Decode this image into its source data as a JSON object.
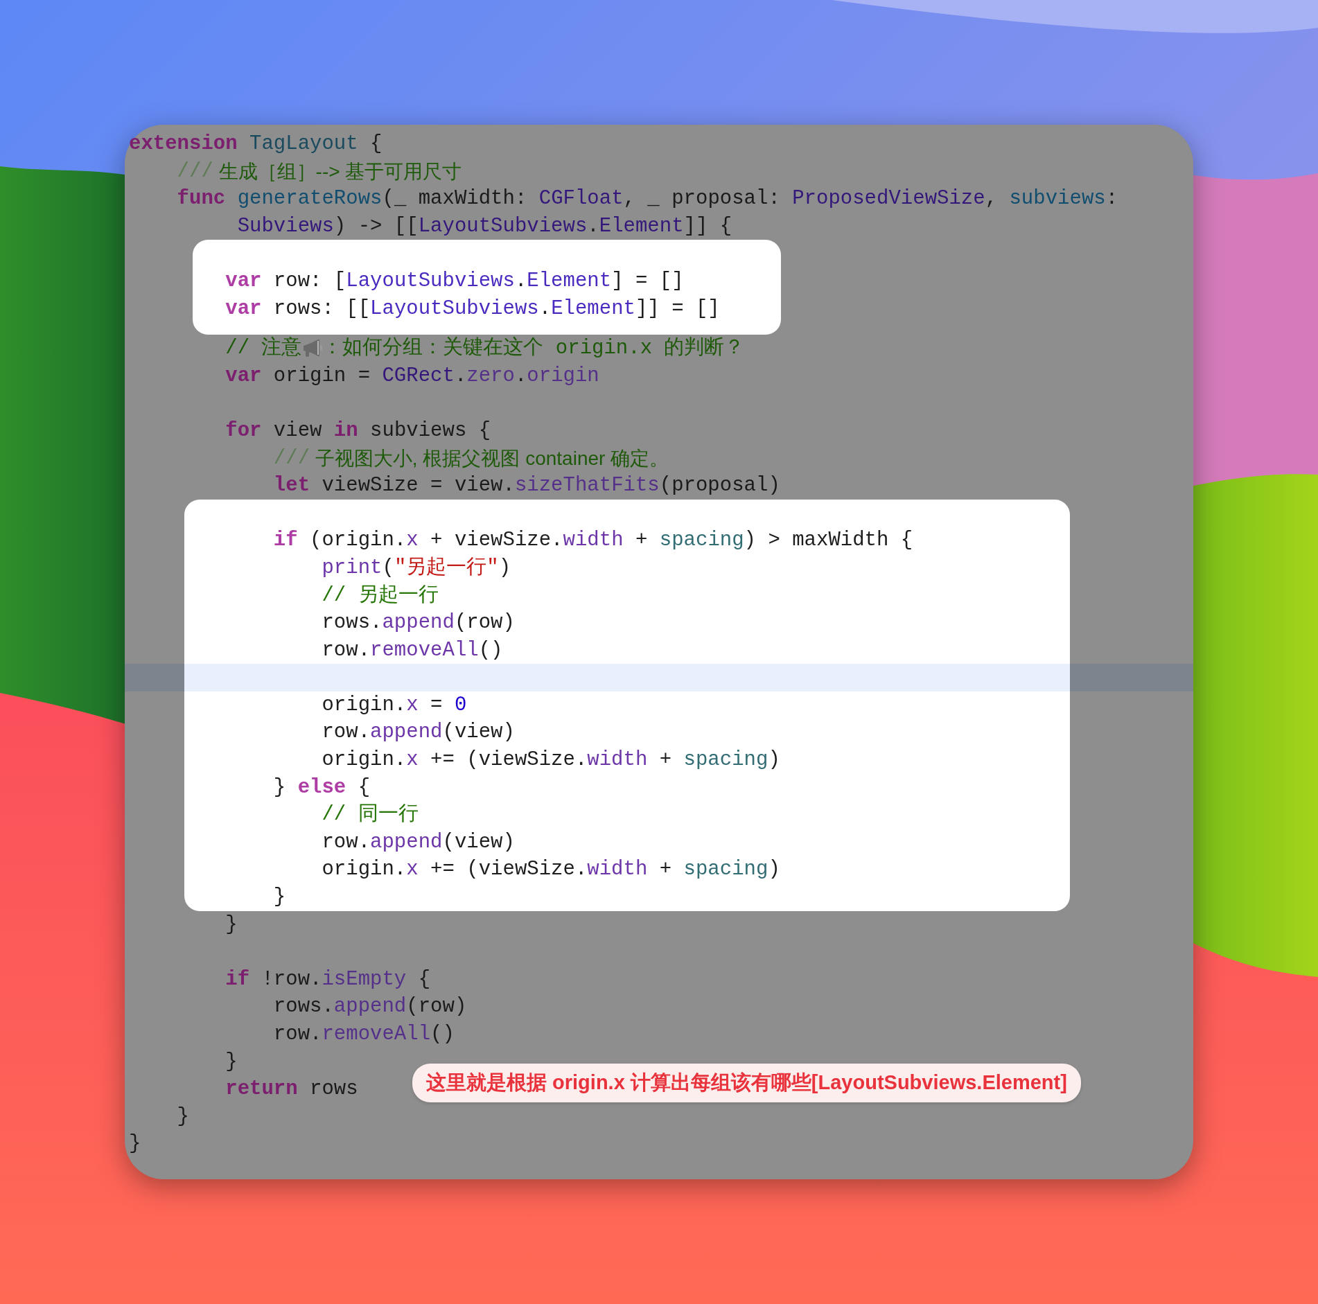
{
  "code_window": {
    "blocks": [
      {
        "highlighted": false,
        "lines": [
          {
            "current": false,
            "tokens": [
              {
                "text": "extension",
                "kind": "keyword"
              },
              {
                "text": " TagLayout",
                "kind": "project-type"
              },
              {
                "text": " {",
                "kind": "plain"
              }
            ]
          },
          {
            "current": false,
            "tokens": [
              {
                "text": "    ///",
                "kind": "doc-marker"
              },
              {
                "text": " 生成［组］--> 基于可用尺寸",
                "kind": "doc"
              }
            ]
          },
          {
            "current": false,
            "tokens": [
              {
                "text": "    func",
                "kind": "keyword"
              },
              {
                "text": " generateRows",
                "kind": "declaration"
              },
              {
                "text": "(_ maxWidth: ",
                "kind": "plain"
              },
              {
                "text": "CGFloat",
                "kind": "system-type"
              },
              {
                "text": ", _ proposal: ",
                "kind": "plain"
              },
              {
                "text": "ProposedViewSize",
                "kind": "system-type"
              },
              {
                "text": ",",
                "kind": "plain"
              },
              {
                "text": " subviews",
                "kind": "declaration"
              },
              {
                "text": ":",
                "kind": "plain"
              }
            ]
          },
          {
            "current": false,
            "tokens": [
              {
                "text": "         Subviews",
                "kind": "system-type"
              },
              {
                "text": ") -> [[",
                "kind": "plain"
              },
              {
                "text": "LayoutSubviews",
                "kind": "system-type"
              },
              {
                "text": ".",
                "kind": "plain"
              },
              {
                "text": "Element",
                "kind": "system-type"
              },
              {
                "text": "]] {",
                "kind": "plain"
              }
            ]
          }
        ]
      },
      {
        "highlighted": true,
        "lines": [
          {
            "current": false
          },
          {
            "current": false,
            "tokens": [
              {
                "text": "        var",
                "kind": "keyword"
              },
              {
                "text": " row: [",
                "kind": "plain"
              },
              {
                "text": "LayoutSubviews",
                "kind": "system-type"
              },
              {
                "text": ".",
                "kind": "plain"
              },
              {
                "text": "Element",
                "kind": "system-type"
              },
              {
                "text": "] = []",
                "kind": "plain"
              }
            ]
          },
          {
            "current": false,
            "tokens": [
              {
                "text": "        var",
                "kind": "keyword"
              },
              {
                "text": " rows: [[",
                "kind": "plain"
              },
              {
                "text": "LayoutSubviews",
                "kind": "system-type"
              },
              {
                "text": ".",
                "kind": "plain"
              },
              {
                "text": "Element",
                "kind": "system-type"
              },
              {
                "text": "]] = []",
                "kind": "plain"
              }
            ]
          }
        ]
      },
      {
        "highlighted": false,
        "lines": [
          {
            "current": false,
            "tokens": [
              {
                "text": "        // 注意",
                "kind": "comment"
              },
              {
                "kind": "megaphone-icon"
              },
              {
                "text": "：如何分组：关键在这个 origin.x 的判断？",
                "kind": "comment"
              }
            ]
          },
          {
            "current": false,
            "tokens": [
              {
                "text": "        var",
                "kind": "keyword"
              },
              {
                "text": " origin = ",
                "kind": "plain"
              },
              {
                "text": "CGRect",
                "kind": "system-type"
              },
              {
                "text": ".",
                "kind": "plain"
              },
              {
                "text": "zero",
                "kind": "property"
              },
              {
                "text": ".",
                "kind": "plain"
              },
              {
                "text": "origin",
                "kind": "property"
              }
            ]
          },
          {
            "current": false
          },
          {
            "current": false,
            "tokens": [
              {
                "text": "        for",
                "kind": "keyword"
              },
              {
                "text": " view ",
                "kind": "plain"
              },
              {
                "text": "in",
                "kind": "keyword"
              },
              {
                "text": " subviews {",
                "kind": "plain"
              }
            ]
          },
          {
            "current": false,
            "tokens": [
              {
                "text": "            ///",
                "kind": "doc-marker"
              },
              {
                "text": " 子视图大小, 根据父视图 container 确定。",
                "kind": "doc"
              }
            ]
          },
          {
            "current": false,
            "tokens": [
              {
                "text": "            let",
                "kind": "keyword"
              },
              {
                "text": " viewSize = view.",
                "kind": "plain"
              },
              {
                "text": "sizeThatFits",
                "kind": "method"
              },
              {
                "text": "(proposal)",
                "kind": "plain"
              }
            ]
          }
        ]
      },
      {
        "highlighted": true,
        "lines": [
          {
            "current": false
          },
          {
            "current": false,
            "tokens": [
              {
                "text": "            if",
                "kind": "keyword"
              },
              {
                "text": " (origin.",
                "kind": "plain"
              },
              {
                "text": "x",
                "kind": "property"
              },
              {
                "text": " + viewSize.",
                "kind": "plain"
              },
              {
                "text": "width",
                "kind": "property"
              },
              {
                "text": " + ",
                "kind": "plain"
              },
              {
                "text": "spacing",
                "kind": "project-property"
              },
              {
                "text": ") > maxWidth {",
                "kind": "plain"
              }
            ]
          },
          {
            "current": false,
            "tokens": [
              {
                "text": "                print",
                "kind": "method"
              },
              {
                "text": "(",
                "kind": "plain"
              },
              {
                "text": "\"另起一行\"",
                "kind": "string"
              },
              {
                "text": ")",
                "kind": "plain"
              }
            ]
          },
          {
            "current": false,
            "tokens": [
              {
                "text": "                // 另起一行",
                "kind": "comment"
              }
            ]
          },
          {
            "current": false,
            "tokens": [
              {
                "text": "                rows.",
                "kind": "plain"
              },
              {
                "text": "append",
                "kind": "method"
              },
              {
                "text": "(row)",
                "kind": "plain"
              }
            ]
          },
          {
            "current": false,
            "tokens": [
              {
                "text": "                row.",
                "kind": "plain"
              },
              {
                "text": "removeAll",
                "kind": "method"
              },
              {
                "text": "()",
                "kind": "plain"
              }
            ]
          },
          {
            "current": true
          },
          {
            "current": false,
            "tokens": [
              {
                "text": "                origin.",
                "kind": "plain"
              },
              {
                "text": "x",
                "kind": "property"
              },
              {
                "text": " = ",
                "kind": "plain"
              },
              {
                "text": "0",
                "kind": "number"
              }
            ]
          },
          {
            "current": false,
            "tokens": [
              {
                "text": "                row.",
                "kind": "plain"
              },
              {
                "text": "append",
                "kind": "method"
              },
              {
                "text": "(view)",
                "kind": "plain"
              }
            ]
          },
          {
            "current": false,
            "tokens": [
              {
                "text": "                origin.",
                "kind": "plain"
              },
              {
                "text": "x",
                "kind": "property"
              },
              {
                "text": " += (viewSize.",
                "kind": "plain"
              },
              {
                "text": "width",
                "kind": "property"
              },
              {
                "text": " + ",
                "kind": "plain"
              },
              {
                "text": "spacing",
                "kind": "project-property"
              },
              {
                "text": ")",
                "kind": "plain"
              }
            ]
          },
          {
            "current": false,
            "tokens": [
              {
                "text": "            } ",
                "kind": "plain"
              },
              {
                "text": "else",
                "kind": "keyword"
              },
              {
                "text": " {",
                "kind": "plain"
              }
            ]
          },
          {
            "current": false,
            "tokens": [
              {
                "text": "                // 同一行",
                "kind": "comment"
              }
            ]
          },
          {
            "current": false,
            "tokens": [
              {
                "text": "                row.",
                "kind": "plain"
              },
              {
                "text": "append",
                "kind": "method"
              },
              {
                "text": "(view)",
                "kind": "plain"
              }
            ]
          },
          {
            "current": false,
            "tokens": [
              {
                "text": "                origin.",
                "kind": "plain"
              },
              {
                "text": "x",
                "kind": "property"
              },
              {
                "text": " += (viewSize.",
                "kind": "plain"
              },
              {
                "text": "width",
                "kind": "property"
              },
              {
                "text": " + ",
                "kind": "plain"
              },
              {
                "text": "spacing",
                "kind": "project-property"
              },
              {
                "text": ")",
                "kind": "plain"
              }
            ]
          },
          {
            "current": false,
            "tokens": [
              {
                "text": "            }",
                "kind": "plain"
              }
            ]
          }
        ]
      },
      {
        "highlighted": false,
        "lines": [
          {
            "current": false,
            "tokens": [
              {
                "text": "        }",
                "kind": "plain"
              }
            ]
          },
          {
            "current": false
          },
          {
            "current": false,
            "tokens": [
              {
                "text": "        if",
                "kind": "keyword"
              },
              {
                "text": " !row.",
                "kind": "plain"
              },
              {
                "text": "isEmpty",
                "kind": "property"
              },
              {
                "text": " {",
                "kind": "plain"
              }
            ]
          },
          {
            "current": false,
            "tokens": [
              {
                "text": "            rows.",
                "kind": "plain"
              },
              {
                "text": "append",
                "kind": "method"
              },
              {
                "text": "(row)",
                "kind": "plain"
              }
            ]
          },
          {
            "current": false,
            "tokens": [
              {
                "text": "            row.",
                "kind": "plain"
              },
              {
                "text": "removeAll",
                "kind": "method"
              },
              {
                "text": "()",
                "kind": "plain"
              }
            ]
          },
          {
            "current": false,
            "tokens": [
              {
                "text": "        }",
                "kind": "plain"
              }
            ]
          },
          {
            "current": false,
            "tokens": [
              {
                "text": "        return",
                "kind": "keyword"
              },
              {
                "text": " rows",
                "kind": "plain"
              }
            ]
          },
          {
            "current": false,
            "tokens": [
              {
                "text": "    }",
                "kind": "plain"
              }
            ]
          },
          {
            "current": false,
            "tokens": [
              {
                "text": "}",
                "kind": "plain"
              }
            ]
          }
        ]
      }
    ],
    "annotation": {
      "text": "这里就是根据 origin.x 计算出每组该有哪些[LayoutSubviews.Element]"
    }
  }
}
